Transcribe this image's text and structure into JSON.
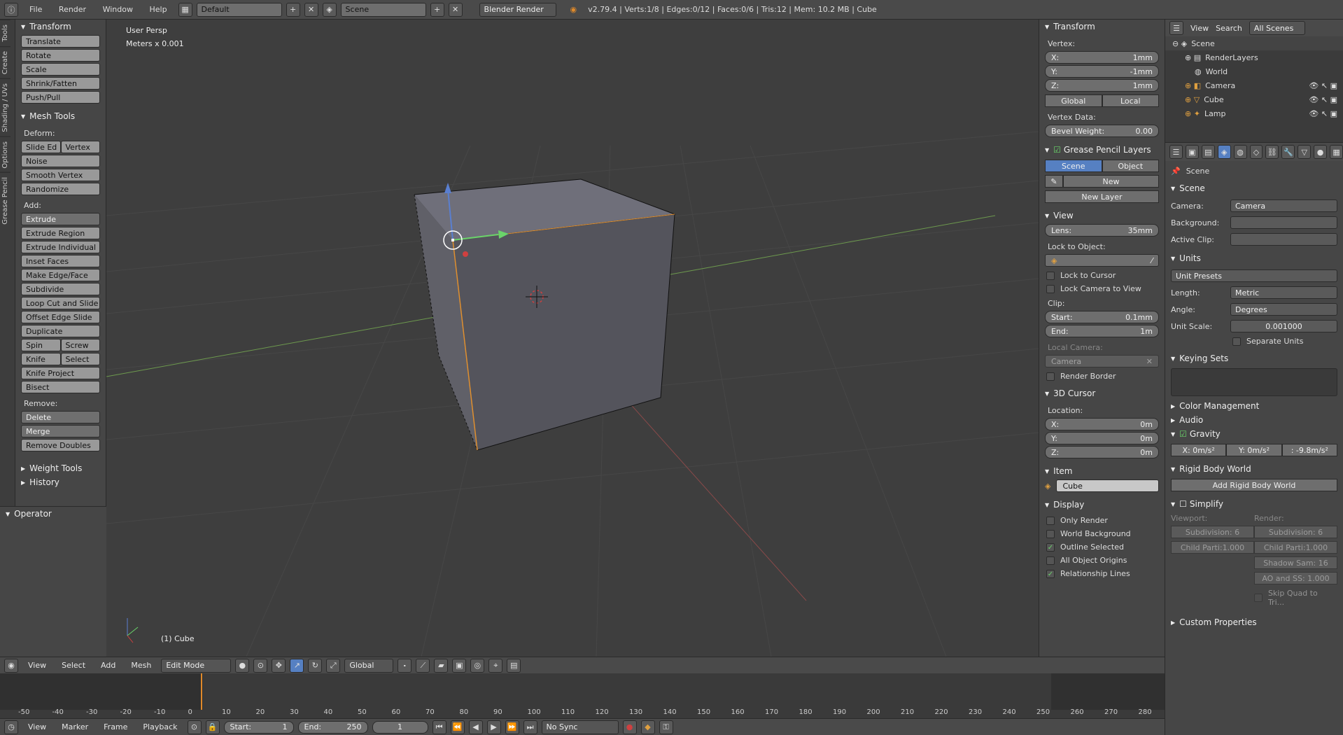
{
  "top": {
    "menus": [
      "File",
      "Render",
      "Window",
      "Help"
    ],
    "layout": "Default",
    "scene": "Scene",
    "engine": "Blender Render",
    "info": "v2.79.4 | Verts:1/8 | Edges:0/12 | Faces:0/6 | Tris:12 | Mem: 10.2 MB | Cube"
  },
  "tabs": [
    "Tools",
    "Create",
    "Shading / UVs",
    "Options",
    "Grease Pencil"
  ],
  "tools": {
    "transform_title": "Transform",
    "transform": [
      "Translate",
      "Rotate",
      "Scale",
      "Shrink/Fatten",
      "Push/Pull"
    ],
    "mesh_title": "Mesh Tools",
    "deform_label": "Deform:",
    "slide_edge": "Slide Ed",
    "vertex": "Vertex",
    "deform": [
      "Noise",
      "Smooth Vertex",
      "Randomize"
    ],
    "add_label": "Add:",
    "extrude": "Extrude",
    "add": [
      "Extrude Region",
      "Extrude Individual",
      "Inset Faces",
      "Make Edge/Face",
      "Subdivide",
      "Loop Cut and Slide",
      "Offset Edge Slide",
      "Duplicate"
    ],
    "spin": "Spin",
    "screw": "Screw",
    "knife": "Knife",
    "select": "Select",
    "add2": [
      "Knife Project",
      "Bisect"
    ],
    "remove_label": "Remove:",
    "delete": "Delete",
    "merge": "Merge",
    "remove_doubles": "Remove Doubles",
    "weight_tools": "Weight Tools",
    "history": "History",
    "operator": "Operator"
  },
  "viewport": {
    "persp": "User Persp",
    "units": "Meters x 0.001",
    "object": "(1) Cube"
  },
  "npanel": {
    "transform": "Transform",
    "vertex_label": "Vertex:",
    "x": "X:",
    "x_val": "1mm",
    "y": "Y:",
    "y_val": "-1mm",
    "z": "Z:",
    "z_val": "1mm",
    "global": "Global",
    "local": "Local",
    "vertex_data": "Vertex Data:",
    "bevel": "Bevel Weight:",
    "bevel_val": "0.00",
    "gp_layers": "Grease Pencil Layers",
    "gp_scene": "Scene",
    "gp_object": "Object",
    "gp_new": "New",
    "gp_new_layer": "New Layer",
    "view": "View",
    "lens": "Lens:",
    "lens_val": "35mm",
    "lock_obj": "Lock to Object:",
    "lock_cursor": "Lock to Cursor",
    "lock_camera": "Lock Camera to View",
    "clip": "Clip:",
    "start": "Start:",
    "start_val": "0.1mm",
    "end": "End:",
    "end_val": "1m",
    "local_camera": "Local Camera:",
    "camera": "Camera",
    "render_border": "Render Border",
    "cursor": "3D Cursor",
    "location": "Location:",
    "cx": "X:",
    "cx_val": "0m",
    "cy": "Y:",
    "cy_val": "0m",
    "cz": "Z:",
    "cz_val": "0m",
    "item": "Item",
    "item_name": "Cube",
    "display": "Display",
    "only_render": "Only Render",
    "world_bg": "World Background",
    "outline_sel": "Outline Selected",
    "all_origins": "All Object Origins",
    "rel_lines": "Relationship Lines"
  },
  "outliner": {
    "view": "View",
    "search": "Search",
    "filter": "All Scenes",
    "items": [
      "Scene",
      "RenderLayers",
      "World",
      "Camera",
      "Cube",
      "Lamp"
    ]
  },
  "props": {
    "context": "Scene",
    "scene_panel": "Scene",
    "camera_k": "Camera:",
    "camera_v": "Camera",
    "background_k": "Background:",
    "active_clip_k": "Active Clip:",
    "units": "Units",
    "unit_presets": "Unit Presets",
    "length_k": "Length:",
    "length_v": "Metric",
    "angle_k": "Angle:",
    "angle_v": "Degrees",
    "scale_k": "Unit Scale:",
    "scale_v": "0.001000",
    "separate": "Separate Units",
    "keying": "Keying Sets",
    "color_mgmt": "Color Management",
    "audio": "Audio",
    "gravity": "Gravity",
    "gx": "X:   0m/s²",
    "gy": "Y:   0m/s²",
    "gz": ":  -9.8m/s²",
    "rbw": "Rigid Body World",
    "add_rbw": "Add Rigid Body World",
    "simplify": "Simplify",
    "viewport": "Viewport:",
    "render": "Render:",
    "subdiv": "Subdivision:",
    "subdiv_v": "6",
    "child": "Child Parti:",
    "child_v": "1.000",
    "shadow": "Shadow Sam:",
    "shadow_v": "16",
    "ao": "AO and SS:",
    "ao_v": "1.000",
    "skip_quad": "Skip Quad to Tri...",
    "custom": "Custom Properties"
  },
  "vphead": {
    "menus": [
      "View",
      "Select",
      "Add",
      "Mesh"
    ],
    "mode": "Edit Mode",
    "orient": "Global"
  },
  "timeline": {
    "ticks": [
      "-50",
      "-40",
      "-30",
      "-20",
      "-10",
      "0",
      "10",
      "20",
      "30",
      "40",
      "50",
      "60",
      "70",
      "80",
      "90",
      "100",
      "110",
      "120",
      "130",
      "140",
      "150",
      "160",
      "170",
      "180",
      "190",
      "200",
      "210",
      "220",
      "230",
      "240",
      "250",
      "260",
      "270",
      "280"
    ]
  },
  "tlhead": {
    "menus": [
      "View",
      "Marker",
      "Frame",
      "Playback"
    ],
    "start": "Start:",
    "start_v": "1",
    "end": "End:",
    "end_v": "250",
    "current": "1",
    "sync": "No Sync"
  }
}
